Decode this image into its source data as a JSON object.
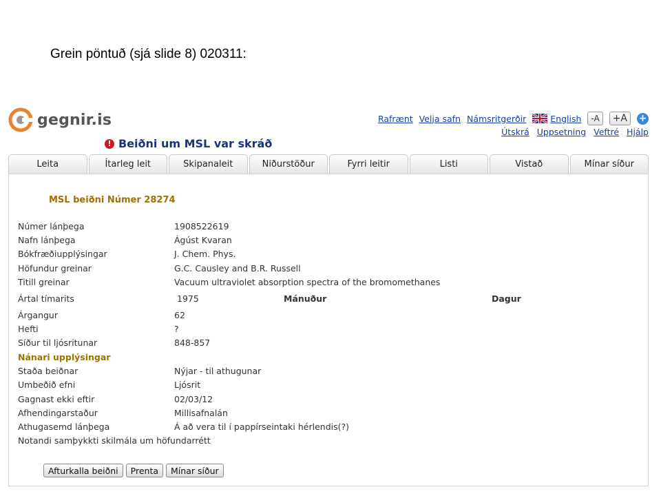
{
  "slide_title": "Grein pöntuð (sjá slide 8) 020311:",
  "logo": {
    "text": "gegnir.is"
  },
  "toplinks": {
    "row1": [
      "Rafrænt",
      "Velja safn",
      "Námsritgerðir"
    ],
    "language": "English",
    "font_smaller": "-A",
    "font_larger": "+A",
    "row2": [
      "Útskrá",
      "Uppsetning",
      "Veftré",
      "Hjálp"
    ]
  },
  "notice": {
    "text": "Beiðni um MSL var skráð"
  },
  "tabs": [
    "Leita",
    "Ítarleg leit",
    "Skipanaleit",
    "Niðurstöður",
    "Fyrri leitir",
    "Listi",
    "Vistað",
    "Mínar síður"
  ],
  "request": {
    "title": "MSL beiðni Númer 28274",
    "borrower_number_label": "Númer lánþega",
    "borrower_number": "1908522619",
    "borrower_name_label": "Nafn lánþega",
    "borrower_name": "Ágúst Kvaran",
    "biblio_label": "Bókfræðiupplýsingar",
    "biblio": "J. Chem. Phys.",
    "author_label": "Höfundur greinar",
    "author": "G.C. Causley and B.R. Russell",
    "article_title_label": "Titill greinar",
    "article_title": "Vacuum ultraviolet absorption spectra of the bromomethanes",
    "year_label": "Ártal tímarits",
    "year": "1975",
    "month_label": "Mánuður",
    "day_label": "Dagur",
    "volume_label": "Árgangur",
    "volume": "62",
    "issue_label": "Hefti",
    "issue": "?",
    "pages_label": "Síður til ljósritunar",
    "pages": "848-857",
    "details_heading": "Nánari upplýsingar",
    "status_label": "Staða beiðnar",
    "status": "Nýjar - til athugunar",
    "requested_label": "Umbeðið efni",
    "requested": "Ljósrit",
    "expires_label": "Gagnast ekki eftir",
    "expires": "02/03/12",
    "pickup_label": "Afhendingarstaður",
    "pickup": "Millisafnalán",
    "note_label": "Athugasemd lánþega",
    "note": "Á að vera til í pappírseintaki hérlendis(?)",
    "copyright": "Notandi samþykkti skilmála um höfundarrétt"
  },
  "buttons": {
    "cancel": "Afturkalla beiðni",
    "print": "Prenta",
    "my_pages": "Mínar síður"
  }
}
